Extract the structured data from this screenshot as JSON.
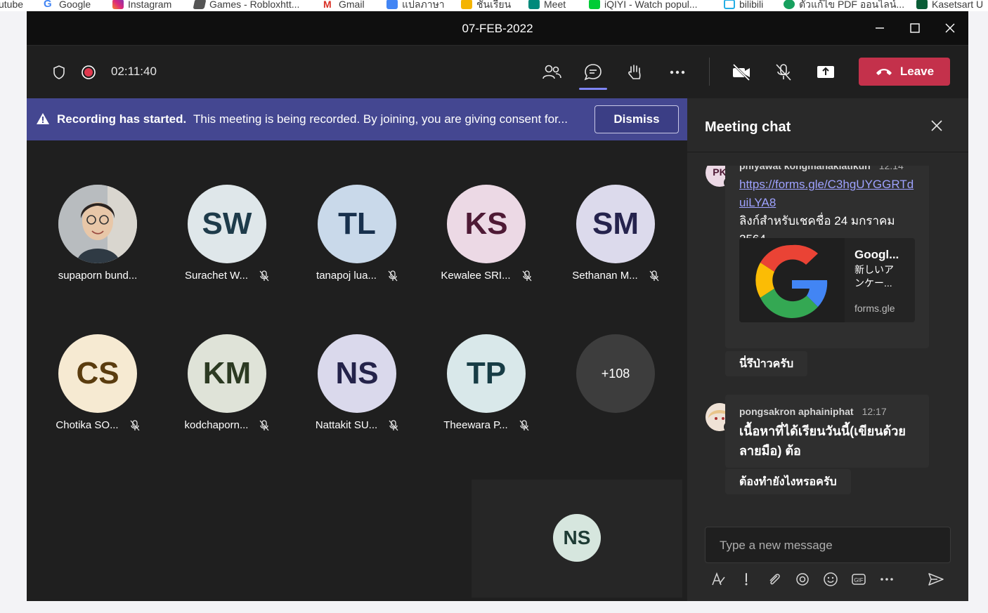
{
  "bookmarks": [
    {
      "label": "utube",
      "icon": "youtube-icon"
    },
    {
      "label": "Google",
      "icon": "google-icon"
    },
    {
      "label": "Instagram",
      "icon": "instagram-icon"
    },
    {
      "label": "Games - Robloxhtt...",
      "icon": "roblox-icon"
    },
    {
      "label": "Gmail",
      "icon": "gmail-icon"
    },
    {
      "label": "แปลภาษา",
      "icon": "translate-icon"
    },
    {
      "label": "ชั้นเรียน",
      "icon": "classroom-icon"
    },
    {
      "label": "Meet",
      "icon": "meet-icon"
    },
    {
      "label": "iQIYI - Watch popul...",
      "icon": "iqiyi-icon"
    },
    {
      "label": "bilibili",
      "icon": "bilibili-icon"
    },
    {
      "label": "ตัวแก้ไข PDF ออนไลน์...",
      "icon": "pdf-editor-icon"
    },
    {
      "label": "Kasetsart U",
      "icon": "ku-icon"
    }
  ],
  "window": {
    "title": "07-FEB-2022"
  },
  "toolbar": {
    "timer": "02:11:40",
    "leave_label": "Leave"
  },
  "banner": {
    "bold_text": "Recording has started.",
    "message": "This meeting is being recorded. By joining, you are giving consent for...",
    "dismiss_label": "Dismiss"
  },
  "participants": [
    {
      "initials": "",
      "name": "supaporn bund...",
      "muted": false,
      "photo": true
    },
    {
      "initials": "SW",
      "name": "Surachet W...",
      "muted": true,
      "bg": "#dfe7ea",
      "fg": "#1e3b4a"
    },
    {
      "initials": "TL",
      "name": "tanapoj lua...",
      "muted": true,
      "bg": "#c9d9ea",
      "fg": "#17304d"
    },
    {
      "initials": "KS",
      "name": "Kewalee SRI...",
      "muted": true,
      "bg": "#ecd9e5",
      "fg": "#4e1a35"
    },
    {
      "initials": "SM",
      "name": "Sethanan M...",
      "muted": true,
      "bg": "#dcdaec",
      "fg": "#25234d"
    },
    {
      "initials": "CS",
      "name": "Chotika SO...",
      "muted": true,
      "bg": "#f6ead2",
      "fg": "#5a3c0e"
    },
    {
      "initials": "KM",
      "name": "kodchaporn...",
      "muted": true,
      "bg": "#dfe3d8",
      "fg": "#2c3a22"
    },
    {
      "initials": "NS",
      "name": "Nattakit SU...",
      "muted": true,
      "bg": "#dad9ec",
      "fg": "#24234a"
    },
    {
      "initials": "TP",
      "name": "Theewara P...",
      "muted": true,
      "bg": "#d9e8ea",
      "fg": "#173c45"
    }
  ],
  "overflow_count": "+108",
  "self_view": {
    "initials": "NS"
  },
  "chat": {
    "title": "Meeting chat",
    "messages": [
      {
        "avatar_initials": "PK",
        "sender": "phiyawat kongmanakiatikun",
        "time": "12:14",
        "link_line1": "https://forms.gle/C3hgUYGGRTd",
        "link_line2": "uiLYA8",
        "text_line1": "ลิงก์สำหรับเชคชื่อ 24 มกราคม",
        "text_line2": "2564",
        "preview": {
          "title": "Googl...",
          "desc_line1": "新しいア",
          "desc_line2": "ンケー...",
          "domain": "forms.gle"
        }
      },
      {
        "sender": "pongsakron aphainiphat",
        "time": "12:17",
        "text_line1": "เนื้อหาที่ได้เรียนวันนี้(เขียนด้วย",
        "text_line2": "ลายมือ) ต้อ"
      }
    ],
    "replies": [
      "นี่รึป่าวครับ",
      "ต้องทำยังไงหรอครับ"
    ],
    "compose_placeholder": "Type a new message"
  },
  "colors": {
    "leave": "#c4314b",
    "banner": "#444791",
    "accent": "#7f85f5",
    "link": "#9ea2ff"
  }
}
